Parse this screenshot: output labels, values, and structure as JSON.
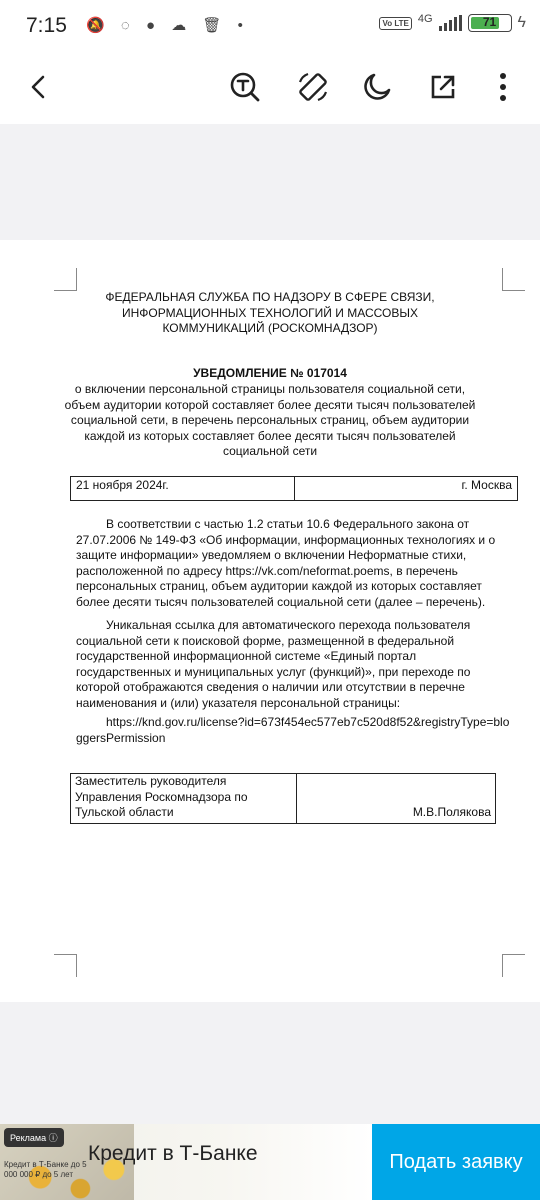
{
  "status_bar": {
    "time": "7:15",
    "network": "4G",
    "volte": "Vo LTE",
    "battery": "71",
    "icons": [
      "dnd-off-icon",
      "whatsapp-icon",
      "chat-icon",
      "cloud-icon",
      "trash-icon",
      "dot-icon"
    ]
  },
  "toolbar": {
    "icons": [
      "back-icon",
      "text-recognition-icon",
      "rotate-icon",
      "night-mode-icon",
      "open-external-icon",
      "more-icon"
    ]
  },
  "document": {
    "agency": "ФЕДЕРАЛЬНАЯ СЛУЖБА ПО НАДЗОРУ В СФЕРЕ СВЯЗИ, ИНФОРМАЦИОННЫХ ТЕХНОЛОГИЙ И МАССОВЫХ КОММУНИКАЦИЙ (РОСКОМНАДЗОР)",
    "title": "УВЕДОМЛЕНИЕ № 017014",
    "subtitle": "о включении персональной страницы пользователя социальной сети, объем аудитории которой составляет более десяти тысяч пользователей социальной сети, в перечень персональных страниц, объем аудитории каждой из которых составляет более десяти тысяч пользователей социальной сети",
    "date": "21 ноября 2024г.",
    "city": "г. Москва",
    "paragraph1": "В соответствии с частью 1.2 статьи 10.6 Федерального закона от 27.07.2006 № 149-ФЗ «Об информации, информационных технологиях и о защите информации» уведомляем о включении Неформатные стихи, расположенной по адресу https://vk.com/neformat.poems, в перечень персональных страниц, объем аудитории каждой из которых составляет более десяти тысяч пользователей социальной сети (далее – перечень).",
    "paragraph2": "Уникальная ссылка для автоматического перехода пользователя социальной сети к поисковой форме, размещенной в федеральной государственной информационной системе «Единый портал государственных и муниципальных услуг (функций)», при переходе по которой отображаются сведения о наличии или отсутствии в перечне наименования и (или) указателя персональной страницы:",
    "link": "https://knd.gov.ru/license?id=673f454ec577eb7c520d8f52&registryType=bloggersPermission",
    "signer_position": "Заместитель руководителя Управления Роскомнадзора по Тульской области",
    "signer_name": "М.В.Полякова"
  },
  "ad": {
    "label": "Реклама ⓘ",
    "fine_print": "Кредит в Т-Банке до 5 000 000 ₽ до 5 лет",
    "title": "Кредит в Т-Банке",
    "button": "Подать заявку"
  }
}
